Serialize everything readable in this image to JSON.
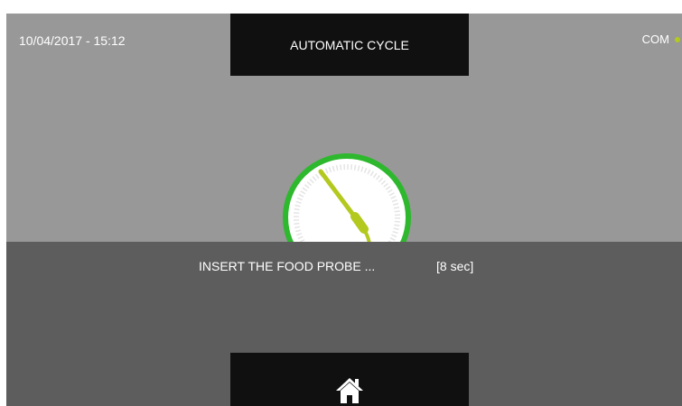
{
  "header": {
    "datetime": "10/04/2017 - 15:12",
    "title": "AUTOMATIC CYCLE",
    "com_label": "COM"
  },
  "status": {
    "message": "INSERT THE FOOD PROBE ...",
    "timer": "[8 sec]"
  },
  "icons": {
    "probe": "food-probe-icon",
    "home": "home-icon"
  },
  "colors": {
    "accent_green": "#2db82d",
    "probe_green": "#b3c91e",
    "com_dot": "#b3c91e",
    "screen_bg": "#989898",
    "overlay_bg": "#5d5d5d",
    "box_bg": "#101010"
  }
}
